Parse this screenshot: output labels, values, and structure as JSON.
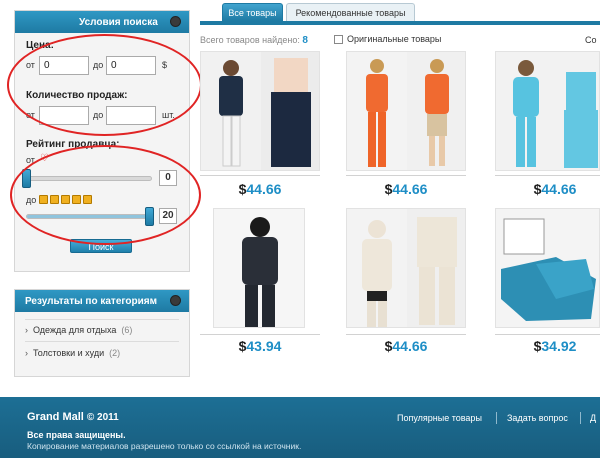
{
  "sidebar": {
    "filter_title": "Условия поиска",
    "price_label": "Цена:",
    "price_from_label": "от",
    "price_from_value": "0",
    "price_to_label": "до",
    "price_to_value": "0",
    "price_currency": "$",
    "sales_label": "Количество продаж:",
    "sales_from_label": "от",
    "sales_to_label": "до",
    "sales_unit": "шт.",
    "rating_label": "Рейтинг продавца:",
    "rating_from_label": "от",
    "rating_from_value": "0",
    "rating_to_label": "до",
    "rating_to_value": "20",
    "search_button": "Поиск"
  },
  "categories": {
    "title": "Результаты по категориям",
    "items": [
      {
        "label": "Одежда для отдыха",
        "count": "(6)"
      },
      {
        "label": "Толстовки и худи",
        "count": "(2)"
      }
    ]
  },
  "tabs": {
    "all": "Все товары",
    "recommended": "Рекомендованные товары"
  },
  "toolbar": {
    "found_label": "Всего товаров найдено:",
    "found_count": "8",
    "original_label": "Оригинальные товары",
    "sort_label": "Со"
  },
  "products": [
    {
      "price": "44.66",
      "currency": "$"
    },
    {
      "price": "44.66",
      "currency": "$"
    },
    {
      "price": "44.66",
      "currency": "$"
    },
    {
      "price": "43.94",
      "currency": "$"
    },
    {
      "price": "44.66",
      "currency": "$"
    },
    {
      "price": "34.92",
      "currency": "$"
    }
  ],
  "footer": {
    "brand": "Grand Mall",
    "year": "© 2011",
    "rights": "Все права защищены.",
    "copy": "Копирование материалов разрешено только со ссылкой на источник.",
    "link_popular": "Популярные товары",
    "link_question": "Задать вопрос",
    "link_more": "Д"
  },
  "colors": {
    "accent": "#1e7aa3",
    "price": "#1e8ec6",
    "annotation": "#e02424"
  }
}
